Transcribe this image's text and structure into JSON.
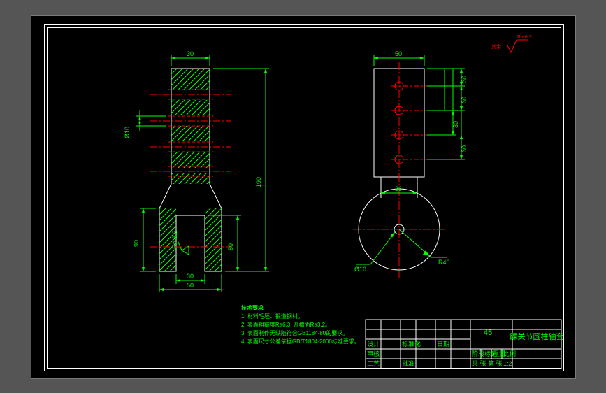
{
  "dimensions": {
    "left_view": {
      "top_width": "30",
      "diameter_hole": "Ø10",
      "overall_height": "190",
      "slot_height": "80",
      "prong_height": "90",
      "slot_width": "30",
      "bottom_width": "50"
    },
    "right_view": {
      "top_width": "50",
      "hole_spacing_1": "30",
      "hole_spacing_2": "30",
      "hole_spacing_3": "30",
      "hole_spacing_4": "30",
      "neck_width": "36",
      "center_hole": "Ø10",
      "radius": "R40"
    }
  },
  "surface_finish": {
    "global": "Ra 6.3",
    "global_label": "其余",
    "local": "Ra 3.2"
  },
  "notes": {
    "heading": "技术要求",
    "line1": "1. 材料毛坯：锻造钢材。",
    "line2": "2. 表面粗糙度Ra6.3, 开槽面Ra3.2。",
    "line3": "3. 表面制作无缺陷符合GB1184-80的要求。",
    "line4": "4. 表面尺寸公差依据GB/T1804-2000标准要求。"
  },
  "title_block": {
    "material": "45",
    "part_name": "踝关节圆柱轴套",
    "scale": "1:2",
    "rows": {
      "design": "设计",
      "check": "审核",
      "process": "工艺",
      "approve": "批准",
      "std_check": "标准化",
      "date": "日期",
      "stage": "阶段标记",
      "weight": "重量",
      "qty": "比例",
      "sheet": "共  张  第  张"
    }
  }
}
